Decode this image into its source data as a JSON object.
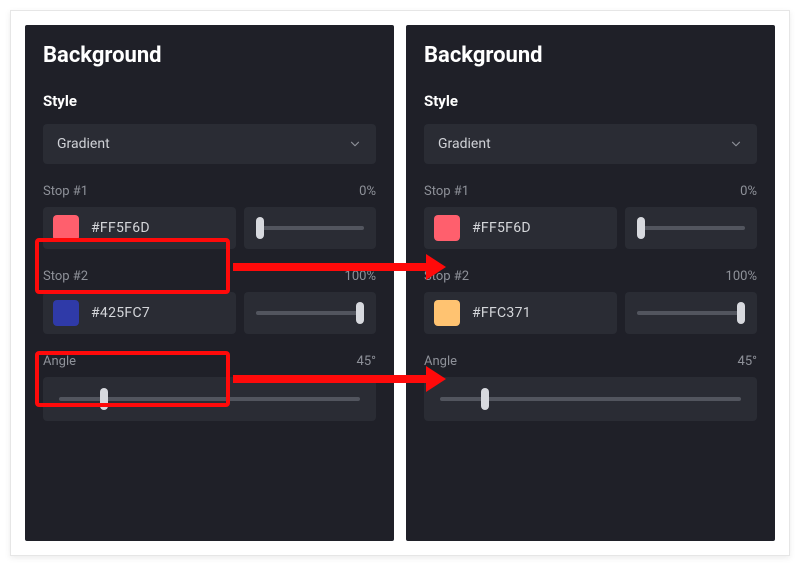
{
  "highlightColor": "#ff0a0a",
  "panels": [
    {
      "title": "Background",
      "styleHeading": "Style",
      "dropdown": {
        "value": "Gradient"
      },
      "stops": [
        {
          "label": "Stop #1",
          "pct": "0%",
          "code": "#FF5F6D",
          "swatch": "#ff5f6d",
          "thumbPct": 4
        },
        {
          "label": "Stop #2",
          "pct": "100%",
          "code": "#425FC7",
          "swatch": "#2f3aa8",
          "thumbPct": 96
        }
      ],
      "angle": {
        "label": "Angle",
        "valueText": "45°",
        "thumbPct": 15
      }
    },
    {
      "title": "Background",
      "styleHeading": "Style",
      "dropdown": {
        "value": "Gradient"
      },
      "stops": [
        {
          "label": "Stop #1",
          "pct": "0%",
          "code": "#FF5F6D",
          "swatch": "#ff5f6d",
          "thumbPct": 4
        },
        {
          "label": "Stop #2",
          "pct": "100%",
          "code": "#FFC371",
          "swatch": "#ffc371",
          "thumbPct": 96
        }
      ],
      "angle": {
        "label": "Angle",
        "valueText": "45°",
        "thumbPct": 15
      }
    }
  ]
}
